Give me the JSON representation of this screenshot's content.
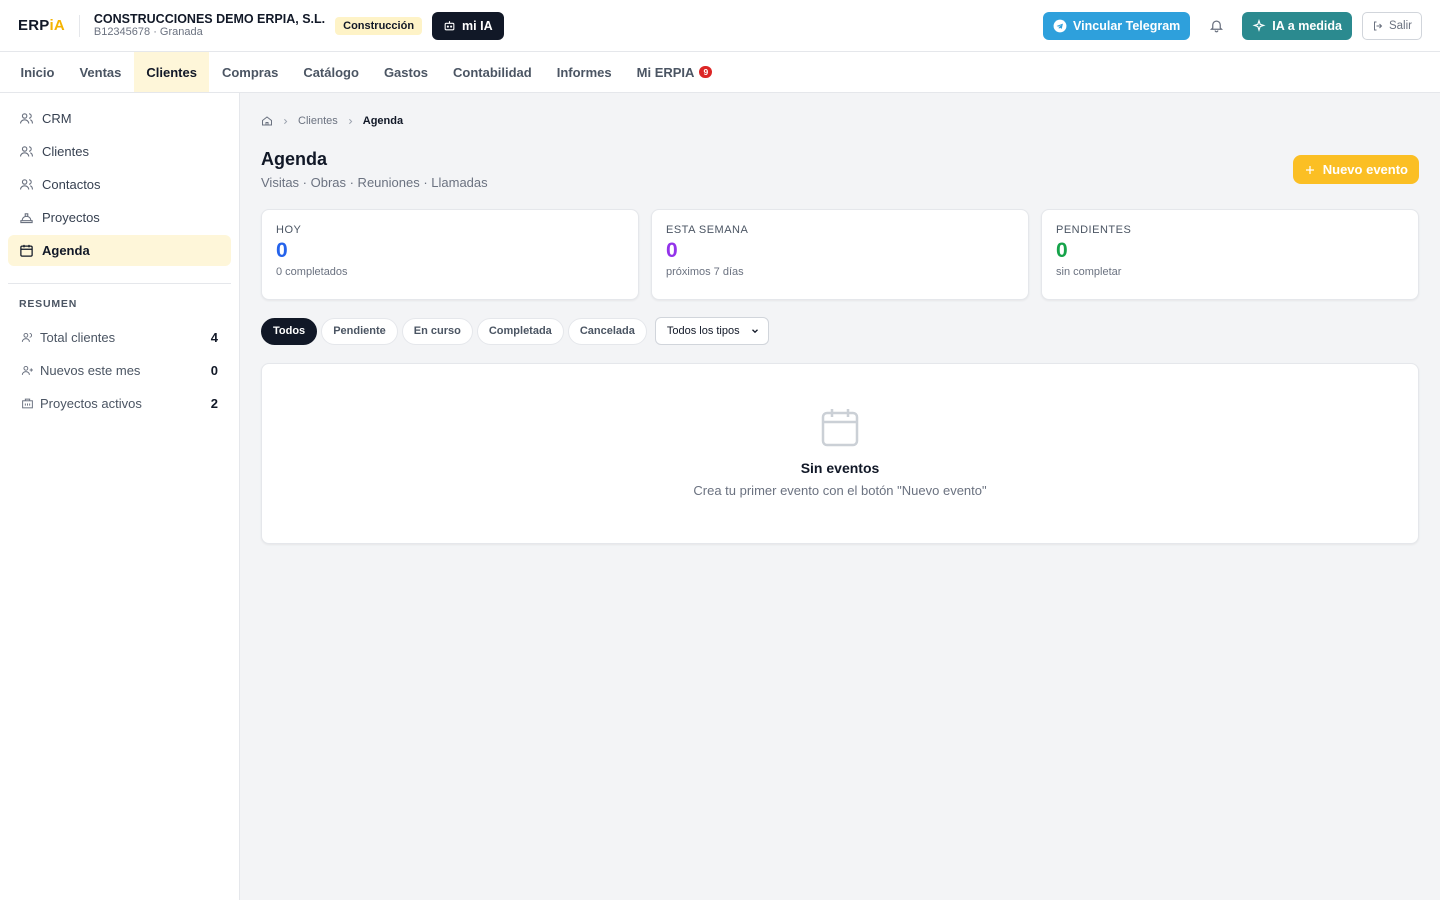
{
  "header": {
    "logo_main": "ERP",
    "logo_accent": "iA",
    "company_name": "CONSTRUCCIONES DEMO ERPIA, S.L.",
    "company_sub": "B12345678 · Granada",
    "sector": "Construcción",
    "mi_ia": "mi IA",
    "telegram": "Vincular Telegram",
    "ia_medida": "IA a medida",
    "salir": "Salir"
  },
  "nav": {
    "items": [
      {
        "label": "Inicio"
      },
      {
        "label": "Ventas"
      },
      {
        "label": "Clientes"
      },
      {
        "label": "Compras"
      },
      {
        "label": "Catálogo"
      },
      {
        "label": "Gastos"
      },
      {
        "label": "Contabilidad"
      },
      {
        "label": "Informes"
      },
      {
        "label": "Mi ERPIA",
        "badge": "9"
      }
    ],
    "active": "Clientes"
  },
  "sidebar": {
    "items": [
      {
        "label": "CRM"
      },
      {
        "label": "Clientes"
      },
      {
        "label": "Contactos"
      },
      {
        "label": "Proyectos"
      },
      {
        "label": "Agenda"
      }
    ],
    "active": "Agenda",
    "summary_heading": "RESUMEN",
    "stats": [
      {
        "label": "Total clientes",
        "value": "4"
      },
      {
        "label": "Nuevos este mes",
        "value": "0"
      },
      {
        "label": "Proyectos activos",
        "value": "2"
      }
    ]
  },
  "breadcrumb": {
    "parent": "Clientes",
    "current": "Agenda"
  },
  "page": {
    "title": "Agenda",
    "subtitle": "Visitas · Obras · Reuniones · Llamadas",
    "new_button": "Nuevo evento"
  },
  "cards": [
    {
      "label": "HOY",
      "value": "0",
      "note": "0 completados",
      "color": "#2563eb"
    },
    {
      "label": "ESTA SEMANA",
      "value": "0",
      "note": "próximos 7 días",
      "color": "#9333ea"
    },
    {
      "label": "PENDIENTES",
      "value": "0",
      "note": "sin completar",
      "color": "#16a34a"
    }
  ],
  "filters": {
    "pills": [
      "Todos",
      "Pendiente",
      "En curso",
      "Completada",
      "Cancelada"
    ],
    "active": "Todos",
    "type_select": "Todos los tipos"
  },
  "empty": {
    "title": "Sin eventos",
    "desc": "Crea tu primer evento con el botón \"Nuevo evento\""
  },
  "colors": {
    "accent": "#fbbf24",
    "dark": "#111827",
    "telegram": "#2ea0dc",
    "teal": "#2b8a8f"
  }
}
